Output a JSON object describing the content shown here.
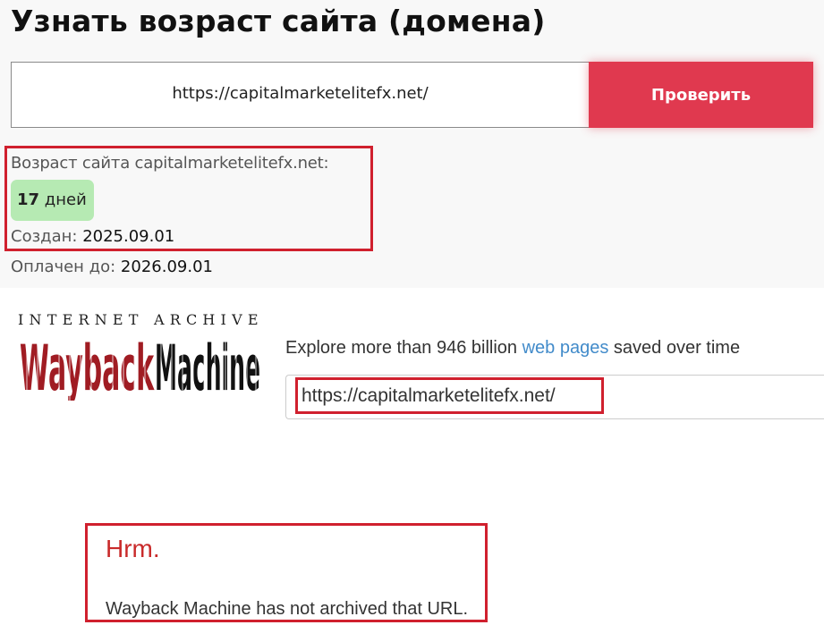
{
  "age_checker": {
    "title": "Узнать возраст сайта (домена)",
    "url_value": "https://capitalmarketelitefx.net/",
    "check_button_label": "Проверить",
    "accent_color": "#e0394f",
    "result": {
      "age_label": "Возраст сайта capitalmarketelitefx.net:",
      "age_number": "17",
      "age_unit": " дней",
      "created_label": "Создан: ",
      "created_date": "2025.09.01",
      "paid_until_label": "Оплачен до: ",
      "paid_until_date": "2026.09.01"
    }
  },
  "wayback": {
    "logo_top": "INTERNET ARCHIVE",
    "logo_main": "WaybackMachine",
    "tagline_prefix": "Explore more than 946 billion ",
    "tagline_link": "web pages",
    "tagline_suffix": " saved over time",
    "search_value": "https://capitalmarketelitefx.net/",
    "error_title": "Hrm.",
    "error_message": "Wayback Machine has not archived that URL."
  },
  "highlight_color": "#d0202e"
}
